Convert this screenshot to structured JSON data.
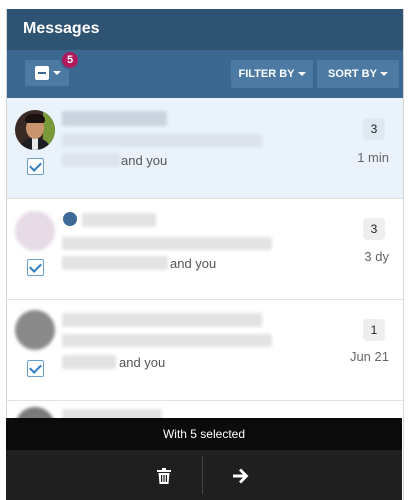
{
  "header": {
    "title": "Messages"
  },
  "toolbar": {
    "selected_count": "5",
    "filter_label": "FILTER BY",
    "sort_label": "SORT BY"
  },
  "messages": [
    {
      "participants_suffix": "and you",
      "count": "3",
      "time": "1 min",
      "selected": true,
      "checked": true
    },
    {
      "participants_suffix": "and you",
      "count": "3",
      "time": "3 dy",
      "selected": false,
      "checked": true
    },
    {
      "participants_suffix": "and you",
      "count": "1",
      "time": "Jun 21",
      "selected": false,
      "checked": true
    }
  ],
  "bulk_bar": {
    "label": "With 5 selected",
    "delete_icon": "trash-icon",
    "move_icon": "arrow-right-icon"
  },
  "colors": {
    "header": "#2f5373",
    "toolbar": "#3b6891",
    "badge": "#b0195c",
    "selected_row": "#eaf3fb"
  }
}
